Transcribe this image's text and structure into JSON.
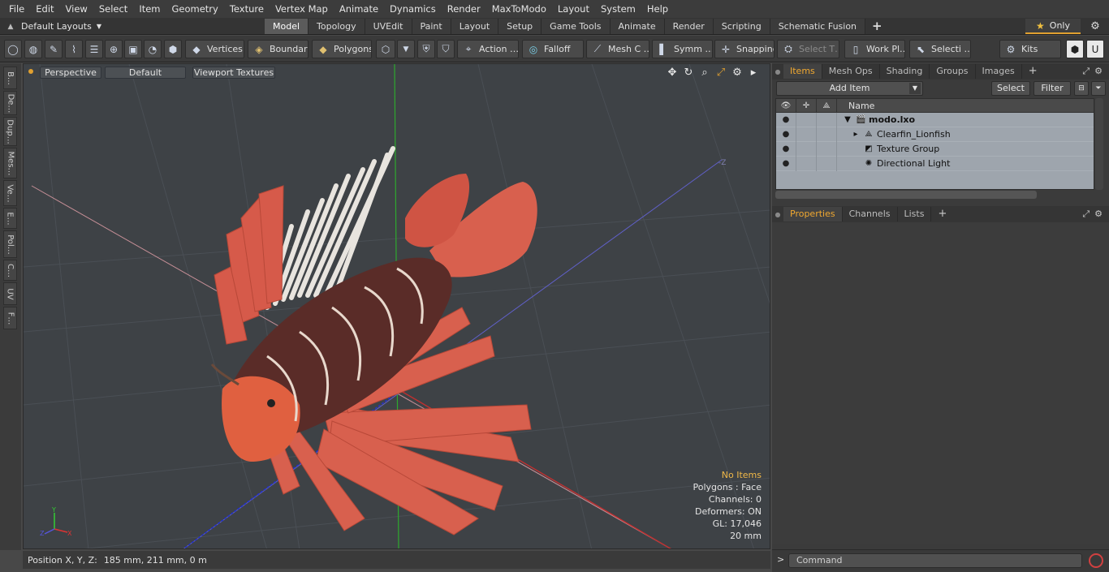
{
  "menu": [
    "File",
    "Edit",
    "View",
    "Select",
    "Item",
    "Geometry",
    "Texture",
    "Vertex Map",
    "Animate",
    "Dynamics",
    "Render",
    "MaxToModo",
    "Layout",
    "System",
    "Help"
  ],
  "layout_selector": "Default Layouts",
  "tabs": [
    "Model",
    "Topology",
    "UVEdit",
    "Paint",
    "Layout",
    "Setup",
    "Game Tools",
    "Animate",
    "Render",
    "Scripting",
    "Schematic Fusion"
  ],
  "active_tab": "Model",
  "only_label": "Only",
  "toolbar": {
    "vertices": "Vertices",
    "boundary": "Boundary",
    "polygons": "Polygons",
    "action": "Action …",
    "falloff": "Falloff",
    "mesh": "Mesh C …",
    "symm": "Symm …",
    "snapping": "Snapping",
    "select_t": "Select T…",
    "work_pl": "Work Pl…",
    "selecti": "Selecti …",
    "kits": "Kits"
  },
  "left_tabs": [
    "B…",
    "De…",
    "Dup…",
    "Mes…",
    "Ve…",
    "E…",
    "Pol…",
    "C…",
    "UV",
    "F…"
  ],
  "viewport": {
    "view_mode": "Perspective",
    "shading": "Default",
    "textures": "Viewport Textures",
    "info": {
      "no_items": "No Items",
      "polygons": "Polygons : Face",
      "channels": "Channels: 0",
      "deformers": "Deformers: ON",
      "gl": "GL: 17,046",
      "scale": "20 mm"
    }
  },
  "status": {
    "position_label": "Position X, Y, Z:",
    "position_value": "185 mm, 211 mm, 0 m"
  },
  "items_panel": {
    "tabs": [
      "Items",
      "Mesh Ops",
      "Shading",
      "Groups",
      "Images"
    ],
    "active": "Items",
    "add_item": "Add Item",
    "select": "Select",
    "filter": "Filter",
    "name_header": "Name",
    "tree": [
      {
        "label": "modo.lxo",
        "bold": true
      },
      {
        "label": "Clearfin_Lionfish",
        "bold": false
      },
      {
        "label": "Texture Group",
        "bold": false
      },
      {
        "label": "Directional Light",
        "bold": false
      }
    ]
  },
  "props_panel": {
    "tabs": [
      "Properties",
      "Channels",
      "Lists"
    ],
    "active": "Properties"
  },
  "command": {
    "prompt": ">",
    "placeholder": "Command"
  },
  "colors": {
    "accent": "#f0a830",
    "viewport_bg": "#3e4246",
    "tree_bg": "#9ea5ad"
  }
}
